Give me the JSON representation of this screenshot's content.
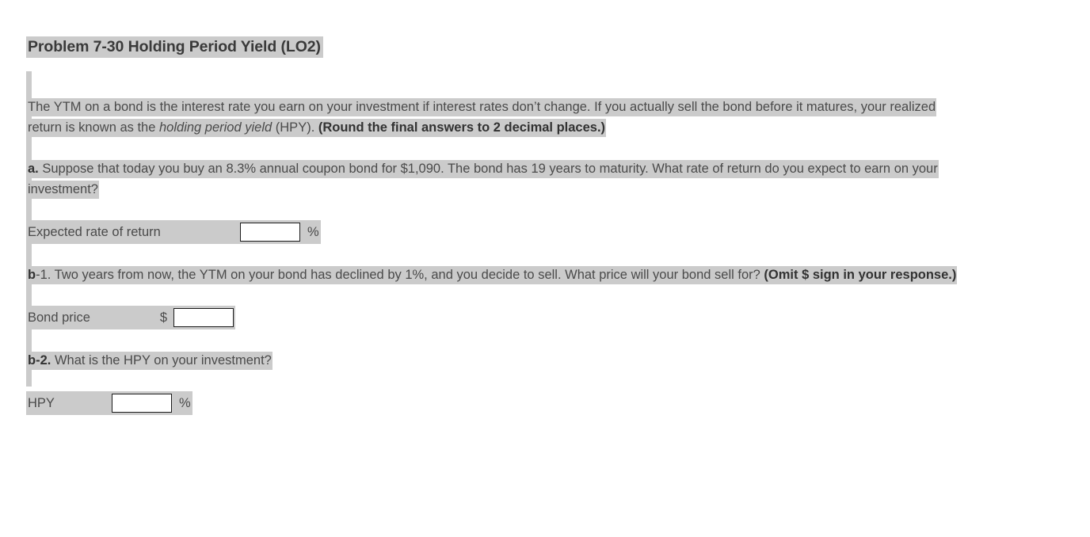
{
  "document": {
    "title": "Problem 7-30 Holding Period Yield (LO2)",
    "intro": {
      "part1": "The YTM on a bond is the interest rate you earn on your investment if interest rates don’t change. If you actually sell the bond before it matures, your realized return is known as the ",
      "italic": "holding period yield",
      "part2": " (HPY). ",
      "bold_note": "(Round the final answers to 2 decimal places.)"
    },
    "questions": [
      {
        "id": "a",
        "label": "a.",
        "text": " Suppose that today you buy an 8.3% annual coupon bond for $1,090. The bond has 19 years to maturity. What rate of return do you expect to earn on your investment?",
        "answer": {
          "label": "Expected rate of return",
          "prefix": "",
          "value": "",
          "placeholder": "",
          "suffix": "%"
        }
      },
      {
        "id": "b-1",
        "label_bold": "b",
        "label_rest": "-1.",
        "text": " Two years from now, the YTM on your bond has declined by 1%, and you decide to sell. What price will your bond sell for? ",
        "bold_note": "(Omit $ sign in your response.)",
        "answer": {
          "label": "Bond price",
          "prefix": "$",
          "value": "",
          "placeholder": "",
          "suffix": ""
        }
      },
      {
        "id": "b-2",
        "label_bold": "b",
        "label_rest": "-2.",
        "text": " What is the HPY on your investment?",
        "answer": {
          "label": "HPY",
          "prefix": "",
          "value": "",
          "placeholder": "",
          "suffix": "%"
        }
      }
    ]
  },
  "colors": {
    "highlight": "#cbcbcb",
    "text": "#4a4a4a",
    "bold_text": "#323232",
    "input_border": "#1c1c1c",
    "page_background": "#ffffff"
  }
}
